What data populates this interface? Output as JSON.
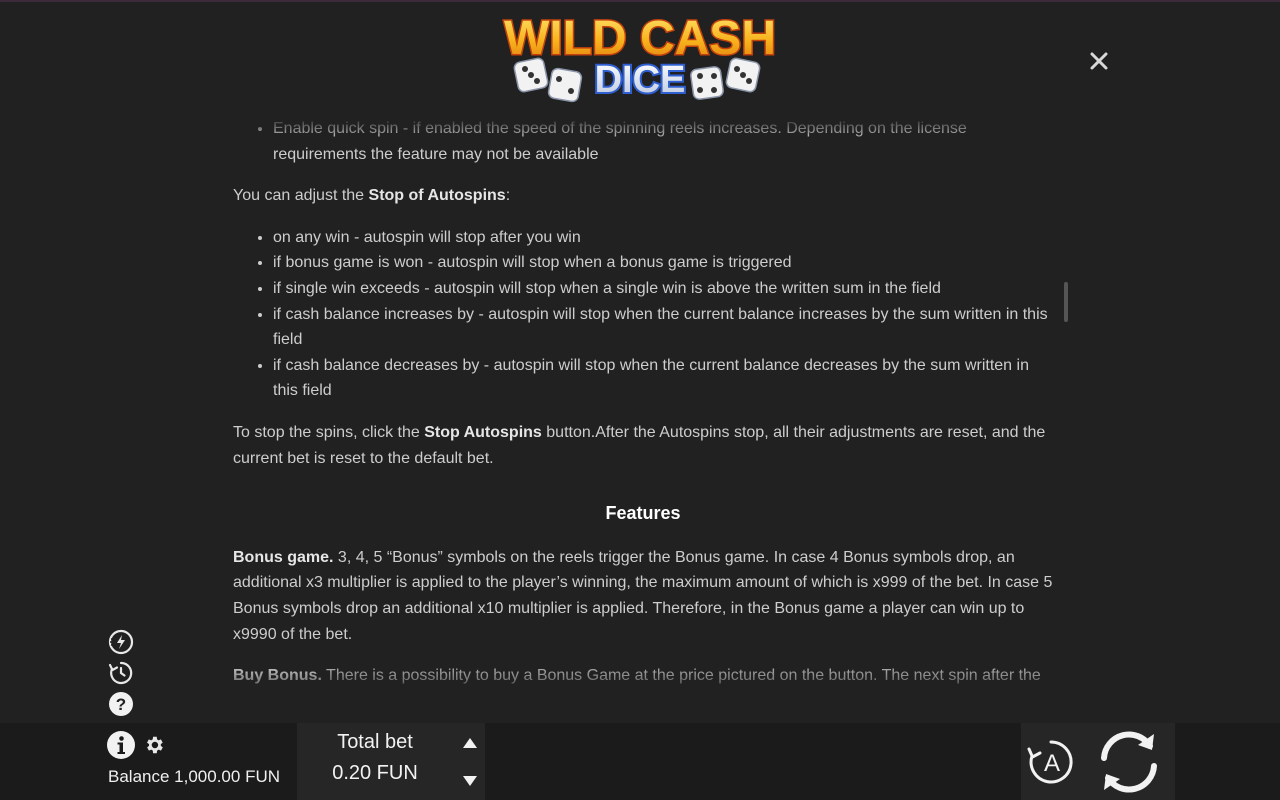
{
  "logo": {
    "line1": "WILD CASH",
    "line2": "DICE"
  },
  "rules": {
    "quickspin_item": "Enable quick spin - if enabled the speed of the spinning reels increases. Depending on the license requirements the feature may not be available",
    "stop_intro_pre": "You can adjust the ",
    "stop_intro_bold": "Stop of Autospins",
    "stop_intro_post": ":",
    "stop_items": [
      "on any win - autospin will stop after you win",
      "if bonus game is won - autospin will stop when a bonus game is triggered",
      "if single win exceeds - autospin will stop when a single win is above the written sum in the field",
      "if cash balance increases by - autospin will stop when the current balance increases by the sum written in this field",
      "if cash balance decreases by - autospin will stop when the current balance decreases by the sum written in this field"
    ],
    "stop_para_pre": "To stop the spins, click the ",
    "stop_para_bold": "Stop Autospins",
    "stop_para_post": " button.After the Autospins stop, all their adjustments are reset, and the current bet is reset to the default bet.",
    "features_title": "Features",
    "bonus_bold": "Bonus game.",
    "bonus_text": " 3, 4, 5 “Bonus” symbols on the reels trigger the Bonus game. In case 4 Bonus symbols drop, an additional x3 multiplier is applied to the player’s winning, the maximum amount of which is x999 of the bet. In case 5 Bonus symbols drop an additional x10 multiplier is applied. Therefore, in the Bonus game a player can win up to x9990 of the bet.",
    "buy_bold": "Buy Bonus.",
    "buy_text": " There is a possibility to buy a Bonus Game at the price pictured on the button. The next spin after the"
  },
  "footer": {
    "balance_label": "Balance",
    "balance_value": "1,000.00 FUN",
    "total_bet_label": "Total bet",
    "total_bet_value": "0.20 FUN"
  },
  "icons": {
    "close": "close-icon",
    "turbo": "turbo-icon",
    "history": "history-icon",
    "help": "help-icon",
    "info": "info-icon",
    "settings": "gear-icon",
    "bet_up": "triangle-up-icon",
    "bet_down": "triangle-down-icon",
    "autoplay": "autoplay-icon",
    "spin": "spin-icon"
  },
  "colors": {
    "background": "#212121",
    "bottom_bar": "#1b1b1b",
    "panel": "#262626",
    "logo_gold": "#f7b21c",
    "logo_blue": "#2f5fd0"
  }
}
